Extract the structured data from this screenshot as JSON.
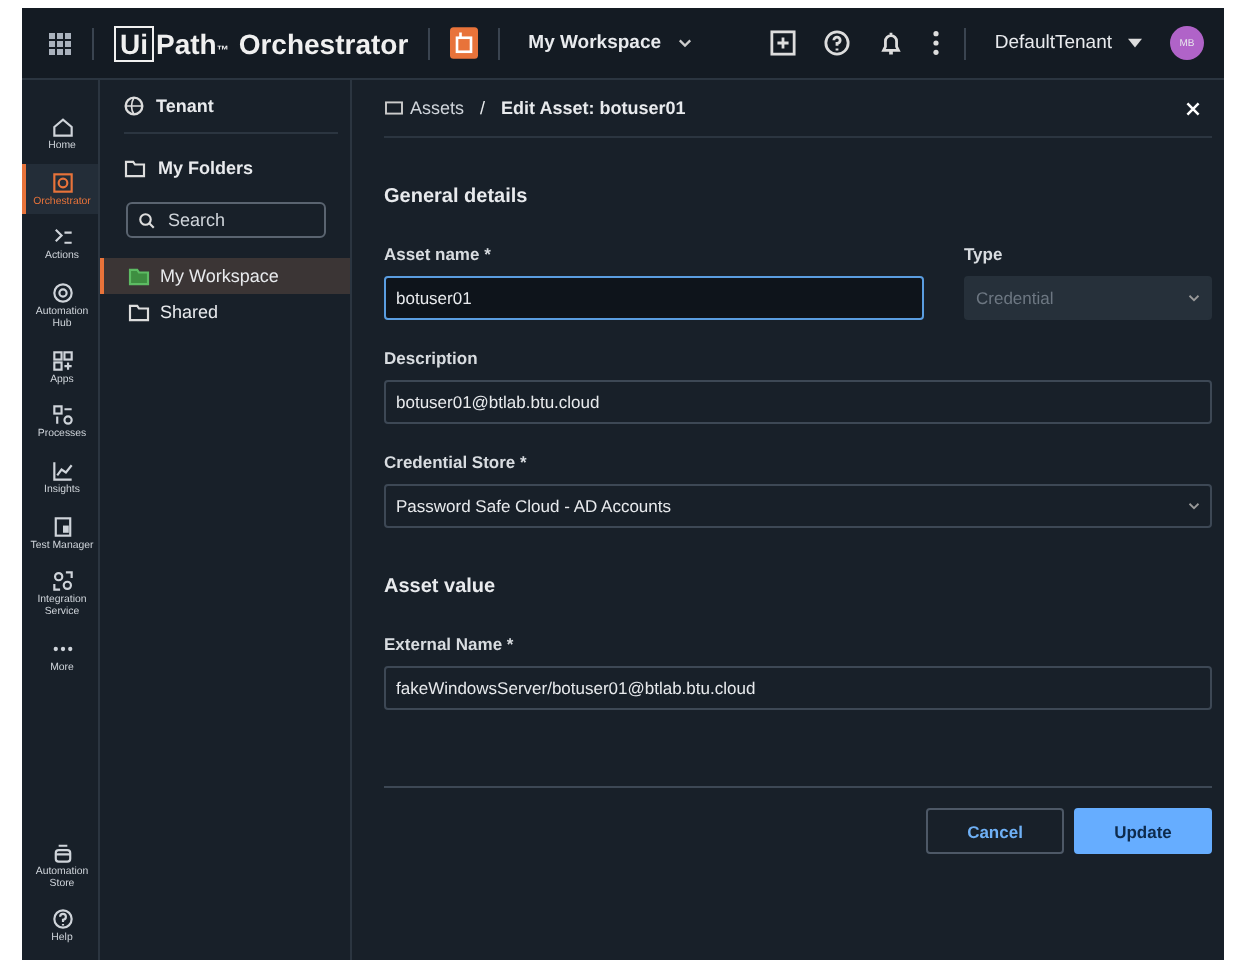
{
  "topbar": {
    "logo_box": "Ui",
    "logo_text": "Path",
    "logo_tm": "™",
    "product": "Orchestrator",
    "workspace": "My Workspace",
    "tenant": "DefaultTenant",
    "avatar": "MB"
  },
  "rail": {
    "items": [
      {
        "label": "Home",
        "selected": false
      },
      {
        "label": "Orchestrator",
        "selected": true
      },
      {
        "label": "Actions",
        "selected": false
      },
      {
        "label": "Automation Hub",
        "selected": false
      },
      {
        "label": "Apps",
        "selected": false
      },
      {
        "label": "Processes",
        "selected": false
      },
      {
        "label": "Insights",
        "selected": false
      },
      {
        "label": "Test Manager",
        "selected": false
      },
      {
        "label": "Integration Service",
        "selected": false
      },
      {
        "label": "More",
        "selected": false
      }
    ],
    "bottom_items": [
      {
        "label": "Automation Store",
        "selected": false
      },
      {
        "label": "Help",
        "selected": false
      }
    ]
  },
  "folders": {
    "tenant": "Tenant",
    "my_folders": "My Folders",
    "search": {
      "placeholder": "Search"
    },
    "items": [
      {
        "label": "My Workspace",
        "selected": true
      },
      {
        "label": "Shared",
        "selected": false
      }
    ]
  },
  "breadcrumb": {
    "parent": "Assets",
    "separator": "/",
    "current": "Edit Asset: botuser01"
  },
  "sections": [
    {
      "title": "General details",
      "fields": [
        {
          "label": "Asset name *",
          "kind": "input",
          "value": "botuser01",
          "focused": true,
          "disabled": false,
          "half": true
        },
        {
          "label": "Type",
          "kind": "select",
          "value": "Credential",
          "focused": false,
          "disabled": true,
          "half": true
        },
        {
          "label": "Description",
          "kind": "input",
          "value": "botuser01@btlab.btu.cloud",
          "focused": false,
          "disabled": false,
          "half": false
        },
        {
          "label": "Credential Store *",
          "kind": "select",
          "value": "Password Safe Cloud - AD Accounts",
          "focused": false,
          "disabled": false,
          "half": false
        }
      ]
    },
    {
      "title": "Asset value",
      "fields": [
        {
          "label": "External Name *",
          "kind": "input",
          "value": "fakeWindowsServer/botuser01@btlab.btu.cloud",
          "focused": false,
          "disabled": false,
          "half": false
        }
      ]
    }
  ],
  "buttons": [
    {
      "label": "Cancel",
      "primary": false
    },
    {
      "label": "Update",
      "primary": true
    }
  ]
}
